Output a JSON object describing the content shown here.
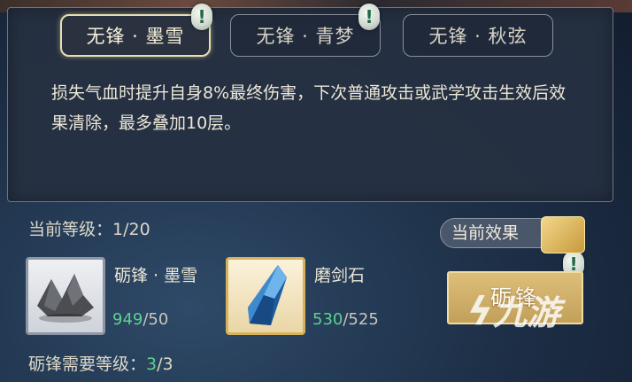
{
  "tabs": [
    {
      "label": "无锋 · 墨雪",
      "active": true
    },
    {
      "label": "无锋 · 青梦",
      "active": false
    },
    {
      "label": "无锋 · 秋弦",
      "active": false
    }
  ],
  "alert_glyph": "!",
  "description": "损失气血时提升自身8%最终伤害，下次普通攻击或武学攻击生效后效果清除，最多叠加10层。",
  "level": {
    "label": "当前等级",
    "separator": "：",
    "value": "1/20"
  },
  "materials": [
    {
      "name": "砺锋 · 墨雪",
      "have": "949",
      "need": "/50",
      "icon": "stone-icon"
    },
    {
      "name": "磨剑石",
      "have": "530",
      "need": "/525",
      "icon": "crystal-icon"
    }
  ],
  "requirement": {
    "label": "砺锋需要等级",
    "separator": "：",
    "have": "3",
    "need": "/3"
  },
  "current_effect": {
    "label": "当前效果"
  },
  "hone_button": {
    "label": "砺锋"
  },
  "watermark": {
    "text": "九游"
  },
  "colors": {
    "accent_green": "#5fd08e",
    "button_gold": "#c2a05a"
  }
}
